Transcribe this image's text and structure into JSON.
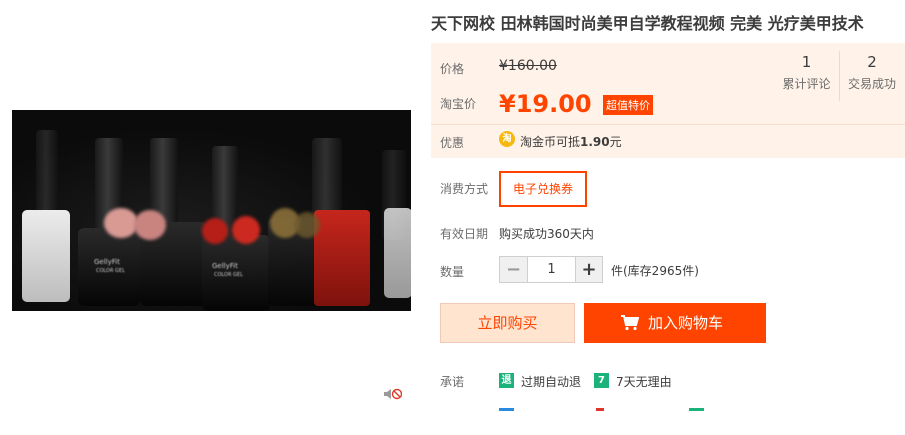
{
  "product": {
    "title": "天下网校 田林韩国时尚美甲自学教程视频 完美 光疗美甲技术"
  },
  "price": {
    "label": "价格",
    "original": "¥160.00",
    "promo_label": "淘宝价",
    "current": "¥19.00",
    "badge": "超值特价"
  },
  "discount": {
    "label": "优惠",
    "icon_text": "淘",
    "text_prefix": "淘金币可抵",
    "amount": "1.90",
    "text_suffix": "元"
  },
  "stats": [
    {
      "num": "1",
      "label": "累计评论"
    },
    {
      "num": "2",
      "label": "交易成功"
    }
  ],
  "consume": {
    "label": "消费方式",
    "option": "电子兑换券"
  },
  "validity": {
    "label": "有效日期",
    "text": "购买成功360天内"
  },
  "quantity": {
    "label": "数量",
    "minus": "−",
    "value": "1",
    "plus": "+",
    "stock": "件(库存2965件)"
  },
  "actions": {
    "buy_now": "立即购买",
    "add_cart": "加入购物车"
  },
  "promise": {
    "label": "承诺",
    "items": [
      {
        "icon": "退",
        "text": "过期自动退",
        "color": "#1bb37b"
      },
      {
        "icon": "7",
        "text": "7天无理由",
        "color": "#1bb37b"
      }
    ]
  },
  "media": {
    "bottle_labels": [
      "GellyFit",
      "COLOR GEL",
      "GellyFit",
      "COLOR GEL"
    ]
  },
  "colors": {
    "accent": "#ff4400",
    "price_bg": "#fff2e8",
    "promise_green": "#1bb37b"
  }
}
